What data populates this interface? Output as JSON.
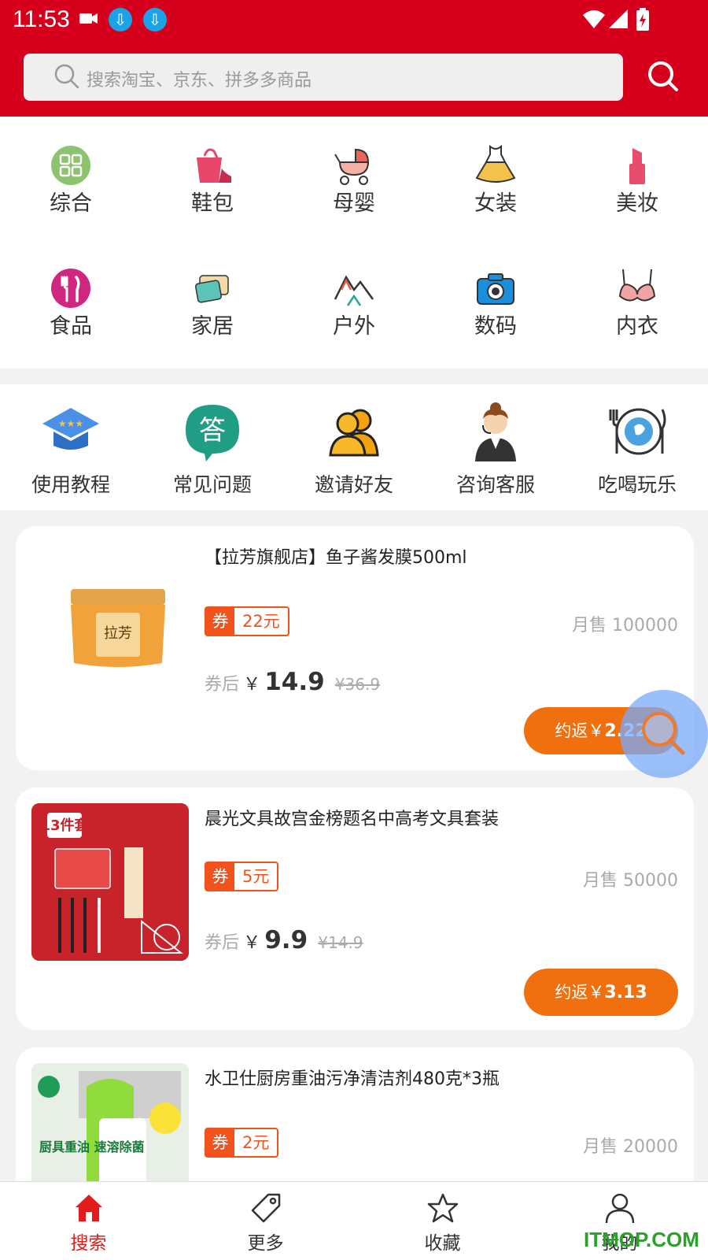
{
  "status_bar": {
    "time": "11:53"
  },
  "search": {
    "placeholder": "搜索淘宝、京东、拼多多商品"
  },
  "categories": [
    {
      "label": "综合",
      "icon": "grid-icon",
      "color": "#8dc36e"
    },
    {
      "label": "鞋包",
      "icon": "handbag-icon",
      "color": "#e8466a"
    },
    {
      "label": "母婴",
      "icon": "stroller-icon",
      "color": "#e9675a"
    },
    {
      "label": "女装",
      "icon": "dress-icon",
      "color": "#f3c24a"
    },
    {
      "label": "美妆",
      "icon": "lipstick-icon",
      "color": "#e84d6e"
    },
    {
      "label": "食品",
      "icon": "fork-knife-icon",
      "color": "#d12680"
    },
    {
      "label": "家居",
      "icon": "towel-icon",
      "color": "#5cc3b6"
    },
    {
      "label": "户外",
      "icon": "mountain-icon",
      "color": "#e05b4c"
    },
    {
      "label": "数码",
      "icon": "camera-icon",
      "color": "#1a8fdd"
    },
    {
      "label": "内衣",
      "icon": "bra-icon",
      "color": "#f2a3a3"
    }
  ],
  "tools": [
    {
      "label": "使用教程",
      "icon": "graduation-cap-icon"
    },
    {
      "label": "常见问题",
      "icon": "answer-bubble-icon"
    },
    {
      "label": "邀请好友",
      "icon": "friends-icon"
    },
    {
      "label": "咨询客服",
      "icon": "customer-service-icon"
    },
    {
      "label": "吃喝玩乐",
      "icon": "dining-plate-icon"
    }
  ],
  "products": [
    {
      "title": "【拉芳旗舰店】鱼子酱发膜500ml",
      "coupon_tag": "券",
      "coupon_value": "22元",
      "sold": "月售 100000",
      "after_label": "券后",
      "yen": "￥",
      "price": "14.9",
      "original_price": "¥36.9",
      "rebate_prefix": "约返￥",
      "rebate_value": "2.22"
    },
    {
      "title": "晨光文具故宫金榜题名中高考文具套装",
      "coupon_tag": "券",
      "coupon_value": "5元",
      "sold": "月售 50000",
      "after_label": "券后",
      "yen": "￥",
      "price": "9.9",
      "original_price": "¥14.9",
      "rebate_prefix": "约返￥",
      "rebate_value": "3.13",
      "thumb_badge": "13件套"
    },
    {
      "title": "水卫仕厨房重油污净清洁剂480克*3瓶",
      "coupon_tag": "券",
      "coupon_value": "2元",
      "sold": "月售 20000",
      "thumb_text": "厨具重油 速溶除菌"
    }
  ],
  "bottom_nav": [
    {
      "label": "搜索",
      "icon": "home-icon",
      "active": true
    },
    {
      "label": "更多",
      "icon": "tag-icon"
    },
    {
      "label": "收藏",
      "icon": "star-icon"
    },
    {
      "label": "我的",
      "icon": "user-icon"
    }
  ],
  "watermark": "ITMOP.COM",
  "colors": {
    "brand_red": "#d6001c",
    "coupon_orange": "#f2521c",
    "rebate_orange": "#f07010"
  }
}
